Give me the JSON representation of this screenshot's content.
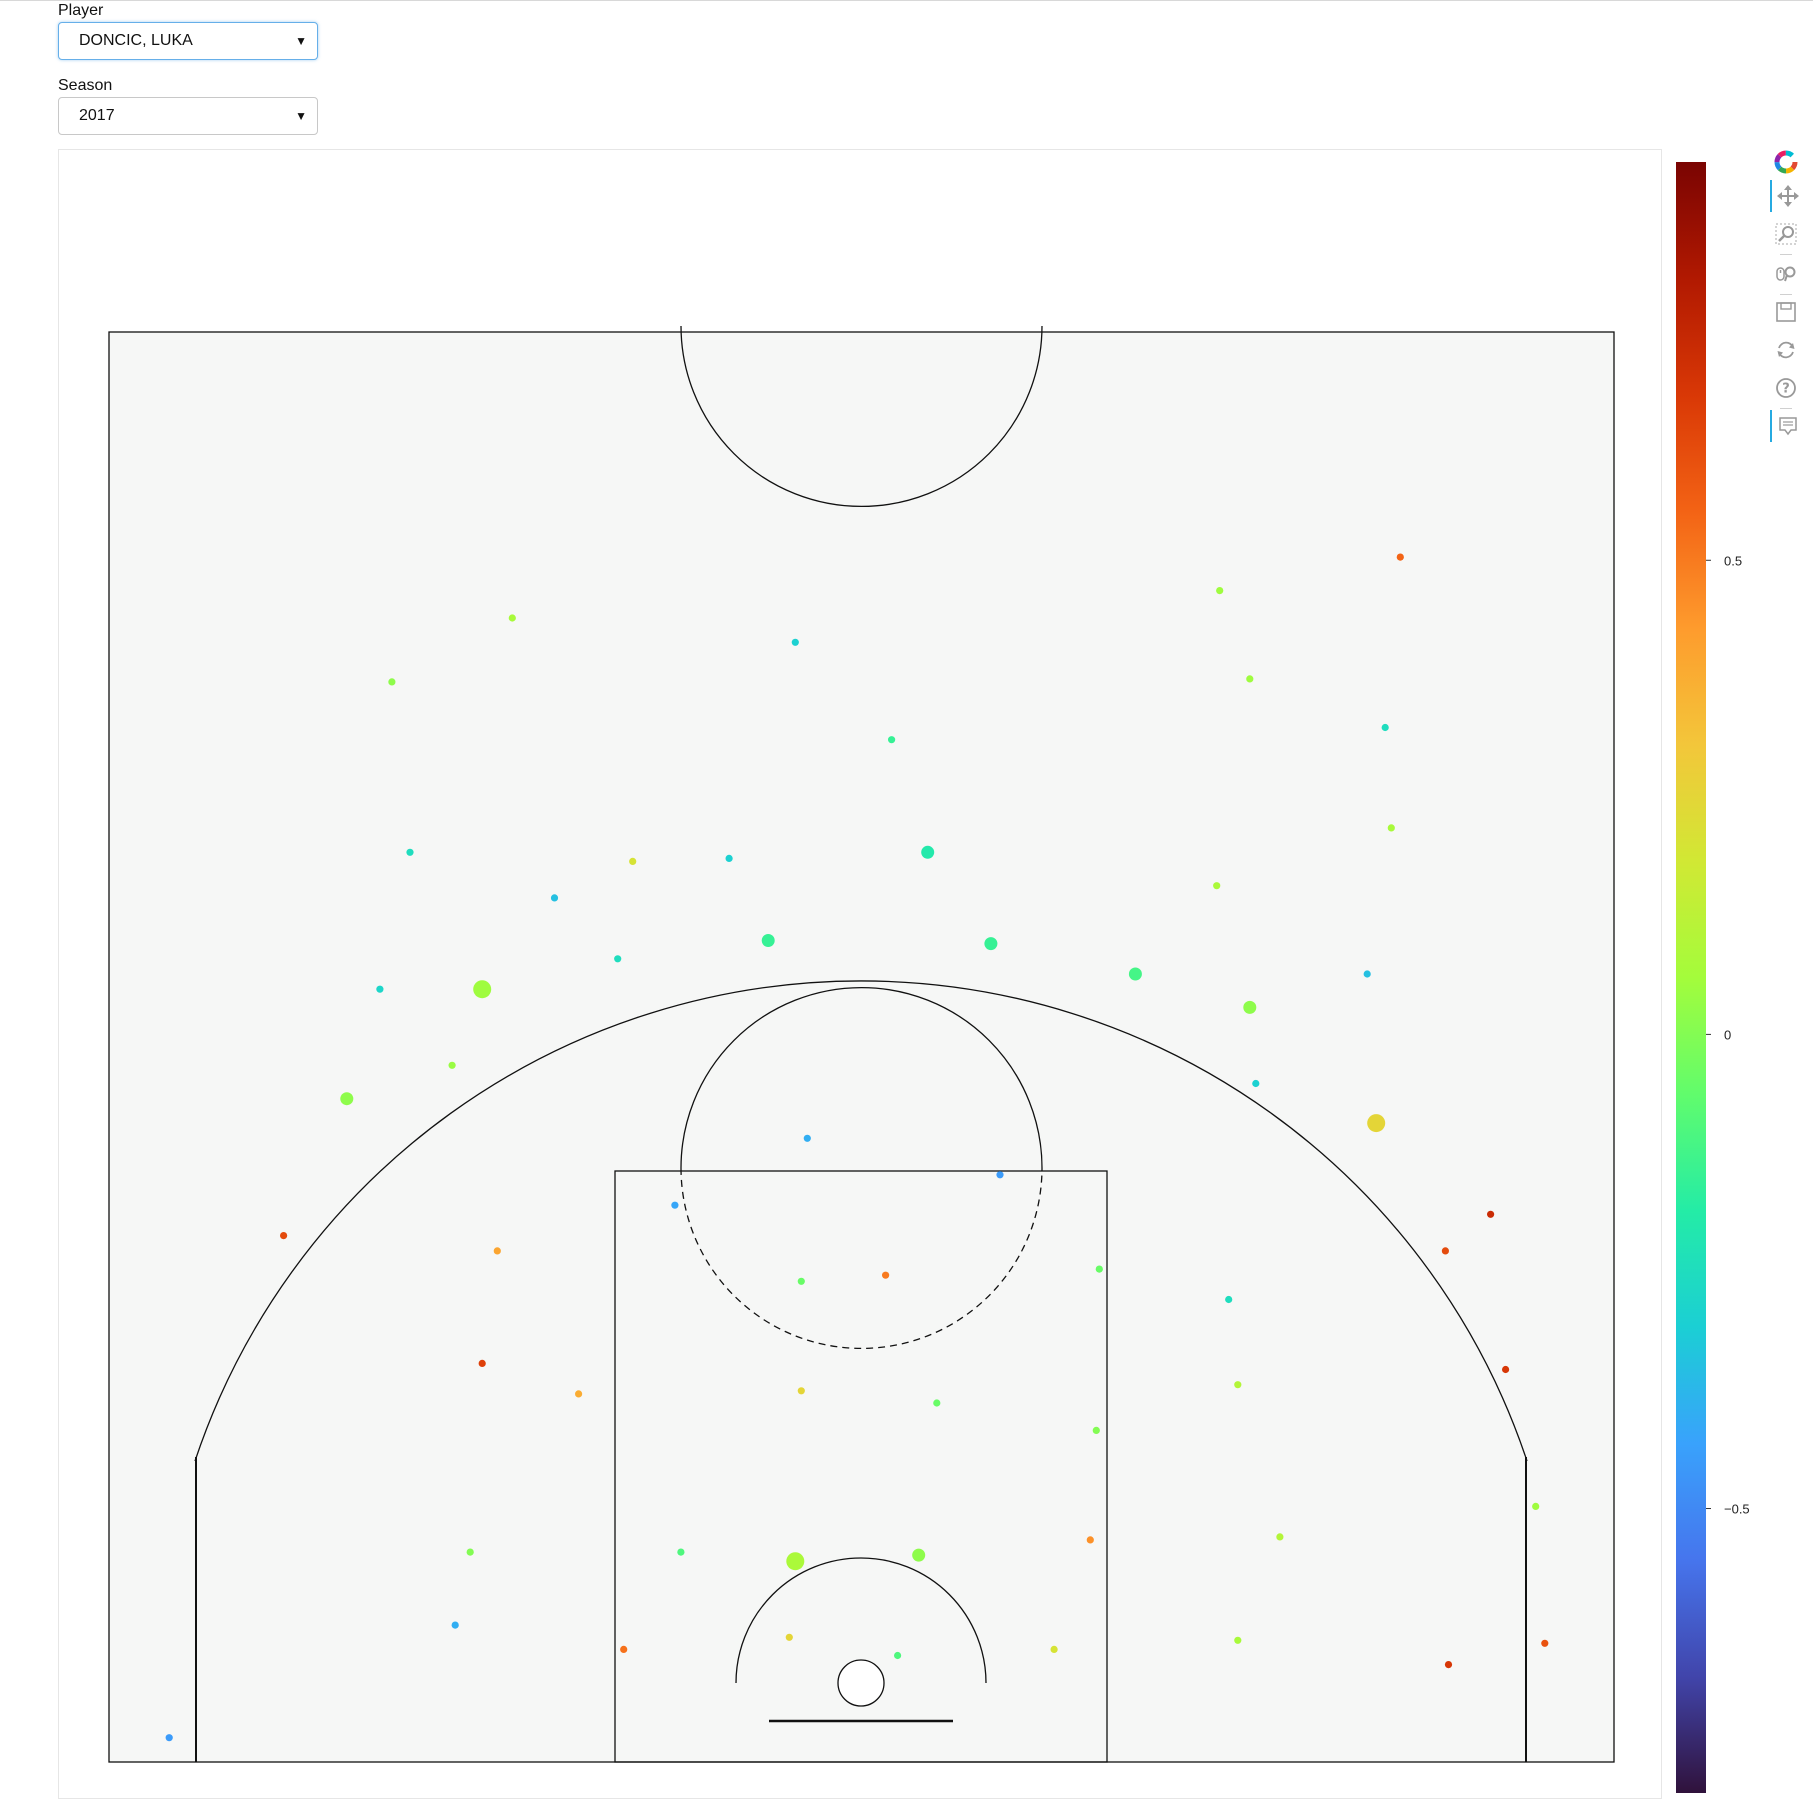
{
  "controls": {
    "player": {
      "label": "Player",
      "value": "DONCIC, LUKA"
    },
    "season": {
      "label": "Season",
      "value": "2017"
    }
  },
  "toolbar": {
    "tools": [
      "bokeh-logo-icon",
      "pan-icon",
      "box-zoom-icon",
      "wheel-zoom-icon",
      "save-icon",
      "reset-icon",
      "help-icon",
      "hover-icon"
    ]
  },
  "colorbar": {
    "ticks": [
      {
        "value": 0.5,
        "label": "0.5"
      },
      {
        "value": 0,
        "label": "0"
      },
      {
        "value": -0.5,
        "label": "−0.5"
      }
    ],
    "range": [
      -0.8,
      0.92
    ],
    "palette": [
      "#30123b",
      "#4145ab",
      "#4675ed",
      "#39a2fc",
      "#1bcfd4",
      "#24eca6",
      "#61fc6c",
      "#a4fc3b",
      "#d1e834",
      "#f3c63a",
      "#fe9b2d",
      "#f36315",
      "#d93806",
      "#b11901",
      "#7a0402"
    ]
  },
  "chart_data": {
    "type": "scatter",
    "title": "",
    "xlabel": "",
    "ylabel": "",
    "grid": false,
    "note_units": "court feet; x from left sideline to the right, y measured from the baseline; colour = value on colorbar",
    "xlim": [
      0,
      50
    ],
    "ylim": [
      0,
      47
    ],
    "points": [
      {
        "x": 2.0,
        "y": 0.8,
        "v": -0.45,
        "s": 1
      },
      {
        "x": 5.8,
        "y": 17.3,
        "v": 0.62,
        "s": 1
      },
      {
        "x": 7.9,
        "y": 21.8,
        "v": 0.02,
        "s": 2
      },
      {
        "x": 9.0,
        "y": 25.4,
        "v": -0.28,
        "s": 1
      },
      {
        "x": 9.4,
        "y": 35.5,
        "v": 0.02,
        "s": 1
      },
      {
        "x": 10.0,
        "y": 29.9,
        "v": -0.25,
        "s": 1
      },
      {
        "x": 11.4,
        "y": 22.9,
        "v": 0.04,
        "s": 1
      },
      {
        "x": 11.5,
        "y": 4.5,
        "v": -0.4,
        "s": 1
      },
      {
        "x": 12.0,
        "y": 6.9,
        "v": 0.0,
        "s": 1
      },
      {
        "x": 12.4,
        "y": 13.1,
        "v": 0.65,
        "s": 1
      },
      {
        "x": 12.4,
        "y": 25.4,
        "v": 0.05,
        "s": 3
      },
      {
        "x": 12.9,
        "y": 16.8,
        "v": 0.4,
        "s": 1
      },
      {
        "x": 13.4,
        "y": 37.6,
        "v": 0.07,
        "s": 1
      },
      {
        "x": 14.8,
        "y": 28.4,
        "v": -0.35,
        "s": 1
      },
      {
        "x": 15.6,
        "y": 12.1,
        "v": 0.38,
        "s": 1
      },
      {
        "x": 16.9,
        "y": 26.4,
        "v": -0.25,
        "s": 1
      },
      {
        "x": 17.1,
        "y": 3.7,
        "v": 0.52,
        "s": 1
      },
      {
        "x": 17.4,
        "y": 29.6,
        "v": 0.2,
        "s": 1
      },
      {
        "x": 18.8,
        "y": 18.3,
        "v": -0.42,
        "s": 1
      },
      {
        "x": 19.0,
        "y": 6.9,
        "v": -0.1,
        "s": 1
      },
      {
        "x": 20.6,
        "y": 29.7,
        "v": -0.3,
        "s": 1
      },
      {
        "x": 21.9,
        "y": 27.0,
        "v": -0.15,
        "s": 2
      },
      {
        "x": 22.6,
        "y": 4.1,
        "v": 0.25,
        "s": 1
      },
      {
        "x": 22.8,
        "y": 6.6,
        "v": 0.08,
        "s": 3
      },
      {
        "x": 22.8,
        "y": 36.8,
        "v": -0.3,
        "s": 1
      },
      {
        "x": 23.0,
        "y": 12.2,
        "v": 0.25,
        "s": 1
      },
      {
        "x": 23.0,
        "y": 15.8,
        "v": -0.05,
        "s": 1
      },
      {
        "x": 23.2,
        "y": 20.5,
        "v": -0.4,
        "s": 1
      },
      {
        "x": 25.8,
        "y": 16.0,
        "v": 0.5,
        "s": 1
      },
      {
        "x": 26.0,
        "y": 33.6,
        "v": -0.15,
        "s": 1
      },
      {
        "x": 26.2,
        "y": 3.5,
        "v": -0.1,
        "s": 1
      },
      {
        "x": 26.9,
        "y": 6.8,
        "v": 0.02,
        "s": 2
      },
      {
        "x": 27.2,
        "y": 29.9,
        "v": -0.2,
        "s": 2
      },
      {
        "x": 27.5,
        "y": 11.8,
        "v": -0.05,
        "s": 1
      },
      {
        "x": 29.3,
        "y": 26.9,
        "v": -0.15,
        "s": 2
      },
      {
        "x": 29.6,
        "y": 19.3,
        "v": -0.45,
        "s": 1
      },
      {
        "x": 31.4,
        "y": 3.7,
        "v": 0.2,
        "s": 1
      },
      {
        "x": 32.6,
        "y": 7.3,
        "v": 0.45,
        "s": 1
      },
      {
        "x": 32.8,
        "y": 10.9,
        "v": 0.0,
        "s": 1
      },
      {
        "x": 32.9,
        "y": 16.2,
        "v": -0.05,
        "s": 1
      },
      {
        "x": 34.1,
        "y": 25.9,
        "v": -0.12,
        "s": 2
      },
      {
        "x": 36.8,
        "y": 28.8,
        "v": 0.08,
        "s": 1
      },
      {
        "x": 36.9,
        "y": 38.5,
        "v": 0.05,
        "s": 1
      },
      {
        "x": 37.2,
        "y": 15.2,
        "v": -0.25,
        "s": 1
      },
      {
        "x": 37.5,
        "y": 4.0,
        "v": 0.07,
        "s": 1
      },
      {
        "x": 37.5,
        "y": 12.4,
        "v": 0.1,
        "s": 1
      },
      {
        "x": 37.9,
        "y": 35.6,
        "v": 0.05,
        "s": 1
      },
      {
        "x": 37.9,
        "y": 24.8,
        "v": 0.02,
        "s": 2
      },
      {
        "x": 38.1,
        "y": 22.3,
        "v": -0.3,
        "s": 1
      },
      {
        "x": 38.9,
        "y": 7.4,
        "v": 0.1,
        "s": 1
      },
      {
        "x": 41.8,
        "y": 25.9,
        "v": -0.35,
        "s": 1
      },
      {
        "x": 42.1,
        "y": 21.0,
        "v": 0.25,
        "s": 3
      },
      {
        "x": 42.4,
        "y": 34.0,
        "v": -0.25,
        "s": 1
      },
      {
        "x": 42.6,
        "y": 30.7,
        "v": 0.07,
        "s": 1
      },
      {
        "x": 42.9,
        "y": 39.6,
        "v": 0.55,
        "s": 1
      },
      {
        "x": 44.4,
        "y": 16.8,
        "v": 0.62,
        "s": 1
      },
      {
        "x": 44.5,
        "y": 3.2,
        "v": 0.68,
        "s": 1
      },
      {
        "x": 45.9,
        "y": 18.0,
        "v": 0.72,
        "s": 1
      },
      {
        "x": 46.4,
        "y": 12.9,
        "v": 0.68,
        "s": 1
      },
      {
        "x": 47.4,
        "y": 8.4,
        "v": 0.05,
        "s": 1
      },
      {
        "x": 47.7,
        "y": 3.9,
        "v": 0.6,
        "s": 1
      }
    ]
  }
}
